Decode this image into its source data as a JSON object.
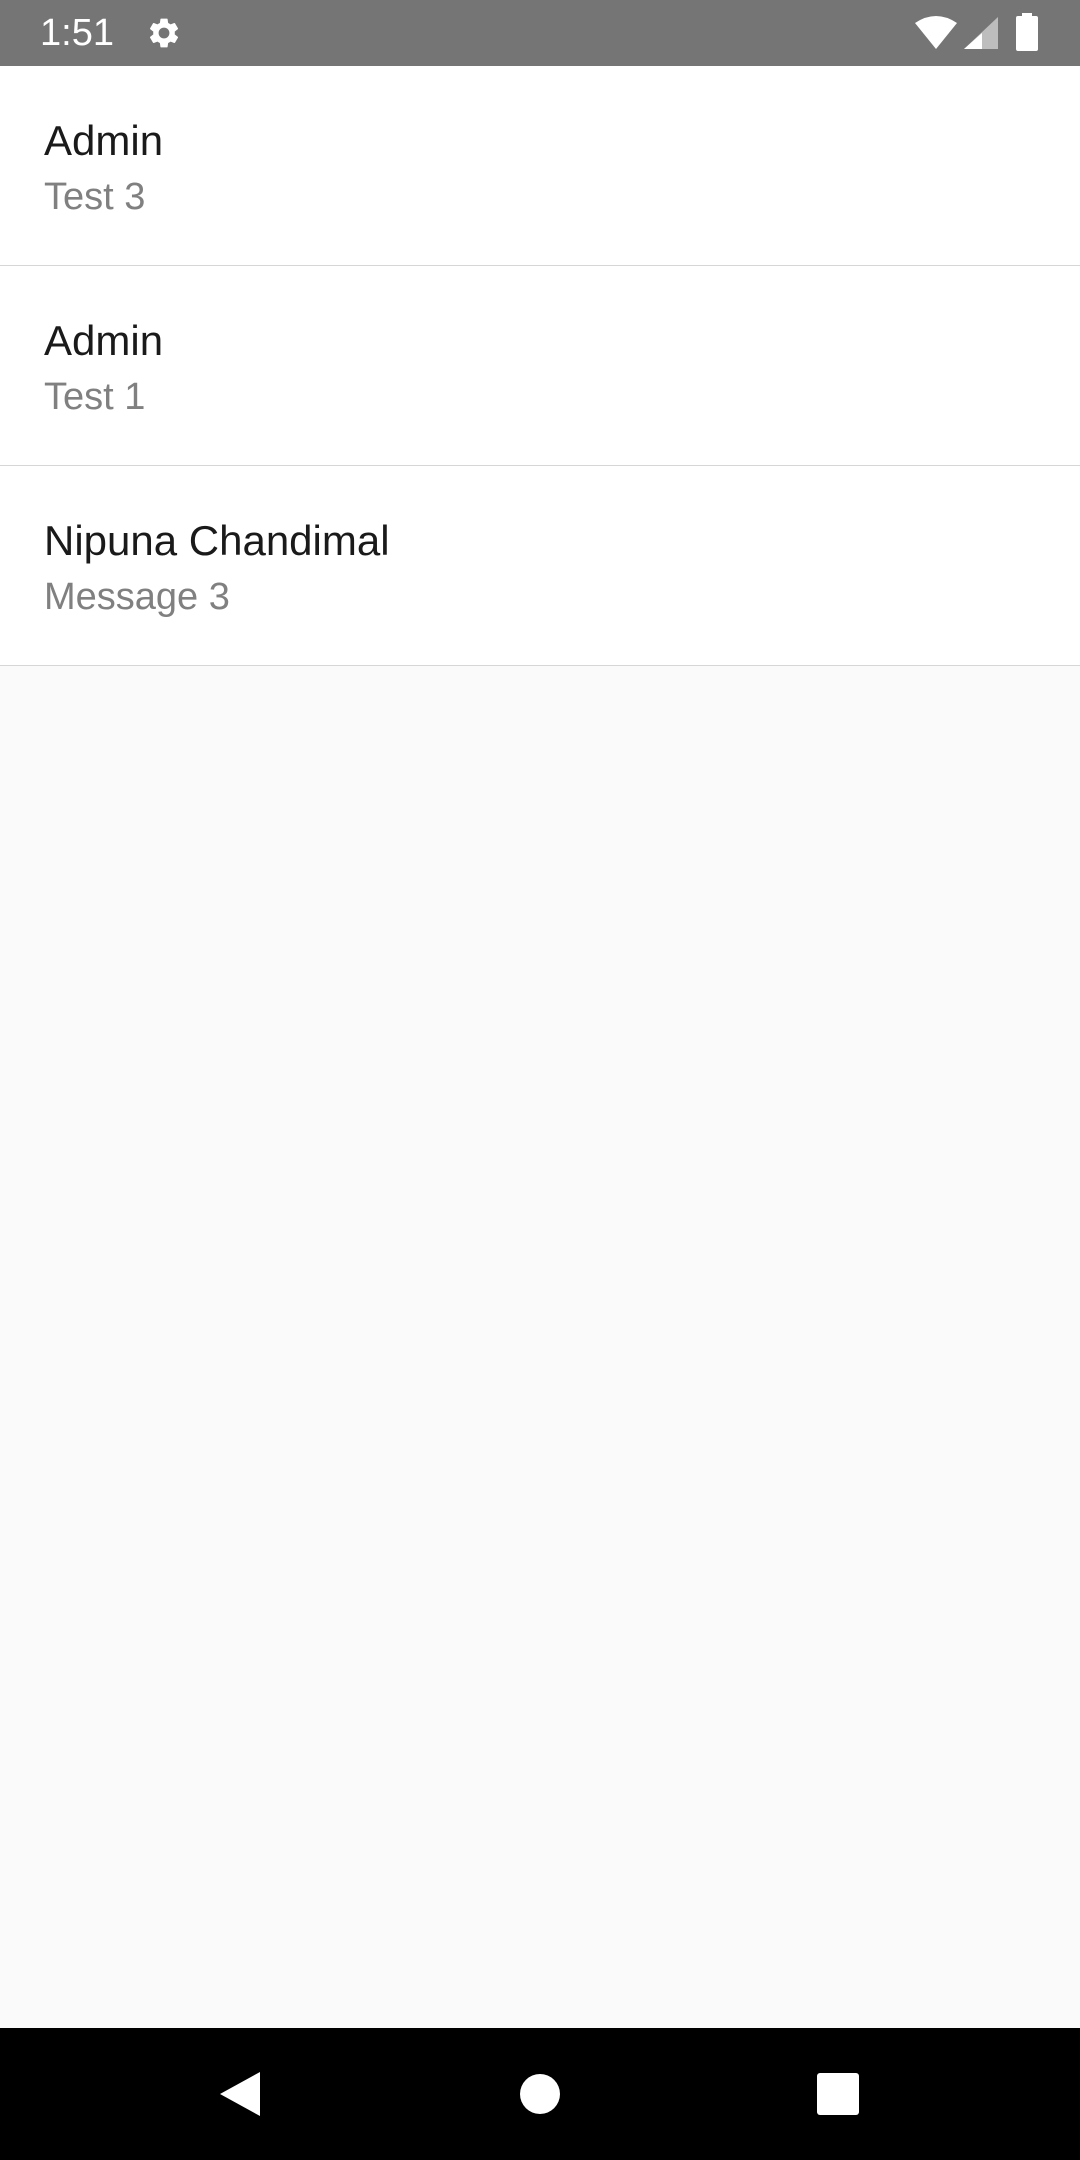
{
  "status_bar": {
    "time": "1:51",
    "icons": [
      "gear-icon",
      "wifi-icon",
      "signal-icon",
      "battery-icon"
    ],
    "background": "#757575"
  },
  "messages": [
    {
      "sender": "Admin",
      "preview": "Test 3"
    },
    {
      "sender": "Admin",
      "preview": "Test 1"
    },
    {
      "sender": "Nipuna Chandimal",
      "preview": "Message 3"
    }
  ],
  "nav_bar": {
    "buttons": [
      "back-icon",
      "home-icon",
      "recents-icon"
    ],
    "background": "#000000"
  },
  "colors": {
    "list_background": "#ffffff",
    "empty_background": "#fafafa",
    "sender_text": "#1a1a1a",
    "preview_text": "#808080",
    "divider": "#d6d6d6"
  }
}
